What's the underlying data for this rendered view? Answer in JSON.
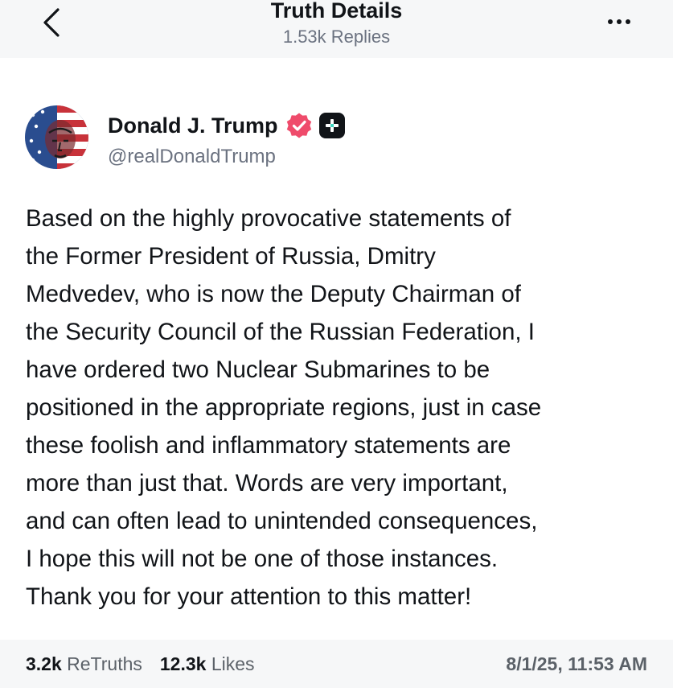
{
  "header": {
    "title": "Truth Details",
    "subtitle": "1.53k Replies",
    "back_icon": "chevron-left-icon",
    "more_icon": "more-horizontal-icon"
  },
  "author": {
    "name": "Donald J. Trump",
    "handle": "@realDonaldTrump",
    "verified_color": "#ef4b6b",
    "badge_icon": "plus-badge-icon"
  },
  "post": {
    "lines": [
      "Based on the highly provocative statements of",
      "the Former President of Russia, Dmitry",
      "Medvedev, who is now the Deputy Chairman of",
      "the Security Council of the Russian Federation, I",
      "have ordered two Nuclear Submarines to be",
      "positioned in the appropriate regions, just in case",
      "these foolish and inflammatory statements are",
      "more than just that. Words are very important,",
      "and can often lead to unintended consequences,",
      "I hope this will not be one of those instances.",
      "Thank you for your attention to this matter!"
    ]
  },
  "footer": {
    "retruths_count": "3.2k",
    "retruths_label": "ReTruths",
    "likes_count": "12.3k",
    "likes_label": "Likes",
    "timestamp": "8/1/25, 11:53 AM"
  }
}
